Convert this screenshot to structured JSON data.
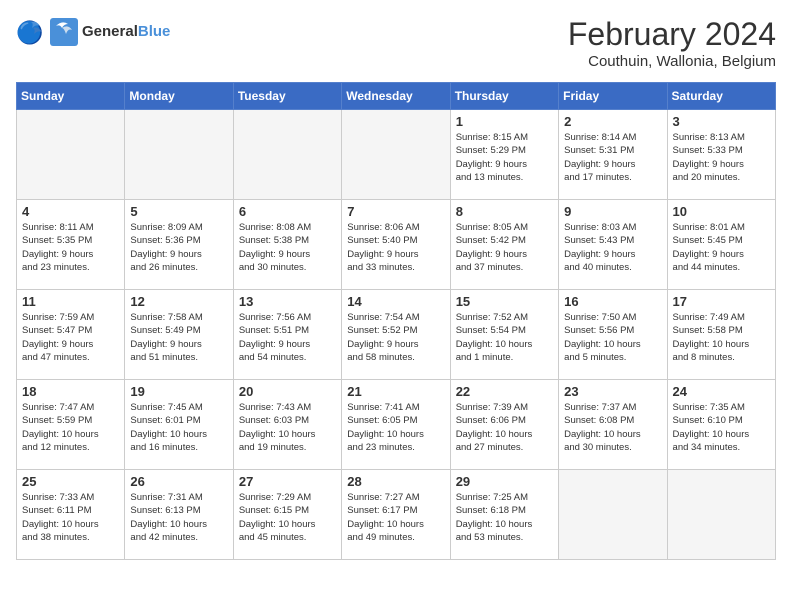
{
  "header": {
    "logo_line1": "General",
    "logo_line2": "Blue",
    "month_year": "February 2024",
    "location": "Couthuin, Wallonia, Belgium"
  },
  "days_of_week": [
    "Sunday",
    "Monday",
    "Tuesday",
    "Wednesday",
    "Thursday",
    "Friday",
    "Saturday"
  ],
  "weeks": [
    [
      {
        "day": "",
        "info": ""
      },
      {
        "day": "",
        "info": ""
      },
      {
        "day": "",
        "info": ""
      },
      {
        "day": "",
        "info": ""
      },
      {
        "day": "1",
        "info": "Sunrise: 8:15 AM\nSunset: 5:29 PM\nDaylight: 9 hours\nand 13 minutes."
      },
      {
        "day": "2",
        "info": "Sunrise: 8:14 AM\nSunset: 5:31 PM\nDaylight: 9 hours\nand 17 minutes."
      },
      {
        "day": "3",
        "info": "Sunrise: 8:13 AM\nSunset: 5:33 PM\nDaylight: 9 hours\nand 20 minutes."
      }
    ],
    [
      {
        "day": "4",
        "info": "Sunrise: 8:11 AM\nSunset: 5:35 PM\nDaylight: 9 hours\nand 23 minutes."
      },
      {
        "day": "5",
        "info": "Sunrise: 8:09 AM\nSunset: 5:36 PM\nDaylight: 9 hours\nand 26 minutes."
      },
      {
        "day": "6",
        "info": "Sunrise: 8:08 AM\nSunset: 5:38 PM\nDaylight: 9 hours\nand 30 minutes."
      },
      {
        "day": "7",
        "info": "Sunrise: 8:06 AM\nSunset: 5:40 PM\nDaylight: 9 hours\nand 33 minutes."
      },
      {
        "day": "8",
        "info": "Sunrise: 8:05 AM\nSunset: 5:42 PM\nDaylight: 9 hours\nand 37 minutes."
      },
      {
        "day": "9",
        "info": "Sunrise: 8:03 AM\nSunset: 5:43 PM\nDaylight: 9 hours\nand 40 minutes."
      },
      {
        "day": "10",
        "info": "Sunrise: 8:01 AM\nSunset: 5:45 PM\nDaylight: 9 hours\nand 44 minutes."
      }
    ],
    [
      {
        "day": "11",
        "info": "Sunrise: 7:59 AM\nSunset: 5:47 PM\nDaylight: 9 hours\nand 47 minutes."
      },
      {
        "day": "12",
        "info": "Sunrise: 7:58 AM\nSunset: 5:49 PM\nDaylight: 9 hours\nand 51 minutes."
      },
      {
        "day": "13",
        "info": "Sunrise: 7:56 AM\nSunset: 5:51 PM\nDaylight: 9 hours\nand 54 minutes."
      },
      {
        "day": "14",
        "info": "Sunrise: 7:54 AM\nSunset: 5:52 PM\nDaylight: 9 hours\nand 58 minutes."
      },
      {
        "day": "15",
        "info": "Sunrise: 7:52 AM\nSunset: 5:54 PM\nDaylight: 10 hours\nand 1 minute."
      },
      {
        "day": "16",
        "info": "Sunrise: 7:50 AM\nSunset: 5:56 PM\nDaylight: 10 hours\nand 5 minutes."
      },
      {
        "day": "17",
        "info": "Sunrise: 7:49 AM\nSunset: 5:58 PM\nDaylight: 10 hours\nand 8 minutes."
      }
    ],
    [
      {
        "day": "18",
        "info": "Sunrise: 7:47 AM\nSunset: 5:59 PM\nDaylight: 10 hours\nand 12 minutes."
      },
      {
        "day": "19",
        "info": "Sunrise: 7:45 AM\nSunset: 6:01 PM\nDaylight: 10 hours\nand 16 minutes."
      },
      {
        "day": "20",
        "info": "Sunrise: 7:43 AM\nSunset: 6:03 PM\nDaylight: 10 hours\nand 19 minutes."
      },
      {
        "day": "21",
        "info": "Sunrise: 7:41 AM\nSunset: 6:05 PM\nDaylight: 10 hours\nand 23 minutes."
      },
      {
        "day": "22",
        "info": "Sunrise: 7:39 AM\nSunset: 6:06 PM\nDaylight: 10 hours\nand 27 minutes."
      },
      {
        "day": "23",
        "info": "Sunrise: 7:37 AM\nSunset: 6:08 PM\nDaylight: 10 hours\nand 30 minutes."
      },
      {
        "day": "24",
        "info": "Sunrise: 7:35 AM\nSunset: 6:10 PM\nDaylight: 10 hours\nand 34 minutes."
      }
    ],
    [
      {
        "day": "25",
        "info": "Sunrise: 7:33 AM\nSunset: 6:11 PM\nDaylight: 10 hours\nand 38 minutes."
      },
      {
        "day": "26",
        "info": "Sunrise: 7:31 AM\nSunset: 6:13 PM\nDaylight: 10 hours\nand 42 minutes."
      },
      {
        "day": "27",
        "info": "Sunrise: 7:29 AM\nSunset: 6:15 PM\nDaylight: 10 hours\nand 45 minutes."
      },
      {
        "day": "28",
        "info": "Sunrise: 7:27 AM\nSunset: 6:17 PM\nDaylight: 10 hours\nand 49 minutes."
      },
      {
        "day": "29",
        "info": "Sunrise: 7:25 AM\nSunset: 6:18 PM\nDaylight: 10 hours\nand 53 minutes."
      },
      {
        "day": "",
        "info": ""
      },
      {
        "day": "",
        "info": ""
      }
    ]
  ]
}
